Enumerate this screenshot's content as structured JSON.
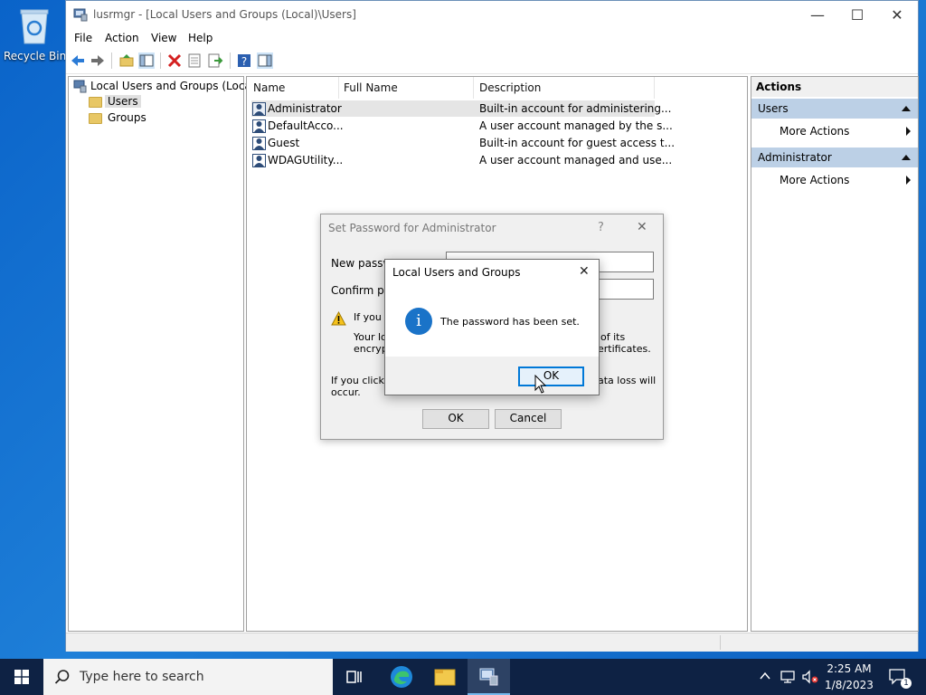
{
  "desktop": {
    "recycle_bin_label": "Recycle Bin"
  },
  "window": {
    "title": "lusrmgr - [Local Users and Groups (Local)\\Users]",
    "minimize_glyph": "—",
    "maximize_glyph": "☐",
    "close_glyph": "✕",
    "menu": [
      "File",
      "Action",
      "View",
      "Help"
    ]
  },
  "tree": {
    "root": "Local Users and Groups (Local)",
    "items": [
      "Users",
      "Groups"
    ]
  },
  "list": {
    "columns": [
      "Name",
      "Full Name",
      "Description"
    ],
    "rows": [
      {
        "name": "Administrator",
        "full_name": "",
        "description": "Built-in account for administering..."
      },
      {
        "name": "DefaultAcco...",
        "full_name": "",
        "description": "A user account managed by the s..."
      },
      {
        "name": "Guest",
        "full_name": "",
        "description": "Built-in account for guest access t..."
      },
      {
        "name": "WDAGUtility...",
        "full_name": "",
        "description": "A user account managed and use..."
      }
    ]
  },
  "actions": {
    "header": "Actions",
    "sections": [
      {
        "title": "Users",
        "item": "More Actions"
      },
      {
        "title": "Administrator",
        "item": "More Actions"
      }
    ]
  },
  "set_password_dialog": {
    "title": "Set Password for Administrator",
    "help_glyph": "?",
    "close_glyph": "✕",
    "new_password_label": "New passwo",
    "confirm_password_label": "Confirm pass",
    "warning_line1": "If you c",
    "warning_line2a": "Your loc",
    "warning_line2b": "of its",
    "warning_line3a": "encrypt",
    "warning_line3b": "ertificates.",
    "note_line1a": "If you click O",
    "note_line1b": "ata loss will",
    "note_line2": "occur.",
    "ok_label": "OK",
    "cancel_label": "Cancel"
  },
  "message_box": {
    "title": "Local Users and Groups",
    "close_glyph": "✕",
    "message": "The password has been set.",
    "info_glyph": "i",
    "ok_label": "OK"
  },
  "taskbar": {
    "search_placeholder": "Type here to search",
    "time": "2:25 AM",
    "date": "1/8/2023",
    "notification_count": "1"
  },
  "colors": {
    "desktop": "#0a63c9",
    "taskbar": "#0e2244",
    "section_header": "#bcd0e6",
    "accent": "#1a73c8"
  }
}
